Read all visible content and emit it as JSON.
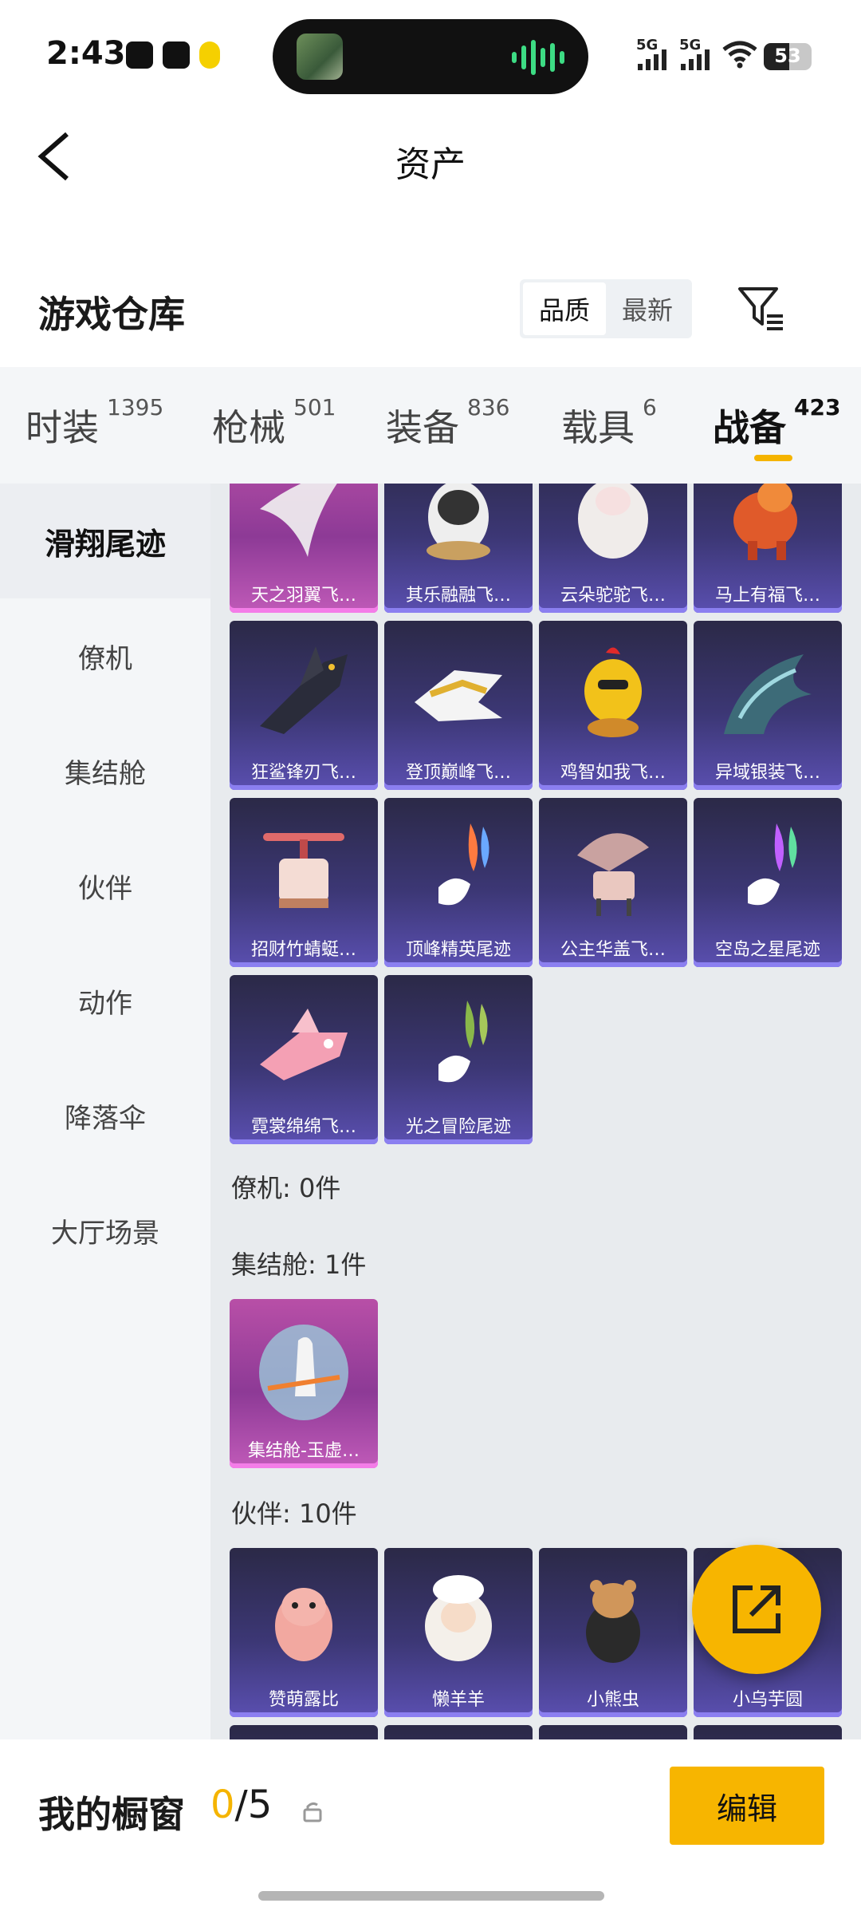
{
  "status_bar": {
    "time": "2:43",
    "network_1": "5G",
    "network_2": "5G",
    "battery": "53",
    "battery_level": 0.53
  },
  "header": {
    "title": "资产"
  },
  "section": {
    "title": "游戏仓库",
    "sort_options": [
      "品质",
      "最新"
    ],
    "active_sort": "品质"
  },
  "tabs": [
    {
      "label": "时装",
      "count": "1395"
    },
    {
      "label": "枪械",
      "count": "501"
    },
    {
      "label": "装备",
      "count": "836"
    },
    {
      "label": "载具",
      "count": "6"
    },
    {
      "label": "战备",
      "count": "423"
    }
  ],
  "active_tab": "战备",
  "sidebar": [
    "滑翔尾迹",
    "僚机",
    "集结舱",
    "伙伴",
    "动作",
    "降落伞",
    "大厅场景"
  ],
  "active_sidebar": "滑翔尾迹",
  "glide_items": [
    {
      "label": "天之羽翼飞…",
      "rarity": "pink"
    },
    {
      "label": "其乐融融飞…",
      "rarity": "purple"
    },
    {
      "label": "云朵驼驼飞…",
      "rarity": "purple"
    },
    {
      "label": "马上有福飞…",
      "rarity": "purple"
    },
    {
      "label": "狂鲨锋刃飞…",
      "rarity": "purple"
    },
    {
      "label": "登顶巅峰飞…",
      "rarity": "purple"
    },
    {
      "label": "鸡智如我飞…",
      "rarity": "purple"
    },
    {
      "label": "异域银装飞…",
      "rarity": "purple"
    },
    {
      "label": "招财竹蜻蜓…",
      "rarity": "purple"
    },
    {
      "label": "顶峰精英尾迹",
      "rarity": "purple"
    },
    {
      "label": "公主华盖飞…",
      "rarity": "purple"
    },
    {
      "label": "空岛之星尾迹",
      "rarity": "purple"
    },
    {
      "label": "霓裳绵绵飞…",
      "rarity": "purple"
    },
    {
      "label": "光之冒险尾迹",
      "rarity": "purple"
    }
  ],
  "categories": [
    {
      "title": "僚机: 0件"
    },
    {
      "title": "集结舱: 1件"
    },
    {
      "title": "伙伴: 10件"
    }
  ],
  "capsule_items": [
    {
      "label": "集结舱-玉虚…",
      "rarity": "pink"
    }
  ],
  "partner_items": [
    {
      "label": "赞萌露比",
      "rarity": "purple"
    },
    {
      "label": "懒羊羊",
      "rarity": "purple"
    },
    {
      "label": "小熊虫",
      "rarity": "purple"
    },
    {
      "label": "小乌芋圆",
      "rarity": "purple"
    }
  ],
  "showcase": {
    "title": "我的橱窗",
    "current": "0",
    "total": "/5",
    "edit_label": "编辑"
  },
  "colors": {
    "accent": "#f7b500",
    "purple_card": "#3c3775",
    "pink_card": "#b84fa7"
  }
}
